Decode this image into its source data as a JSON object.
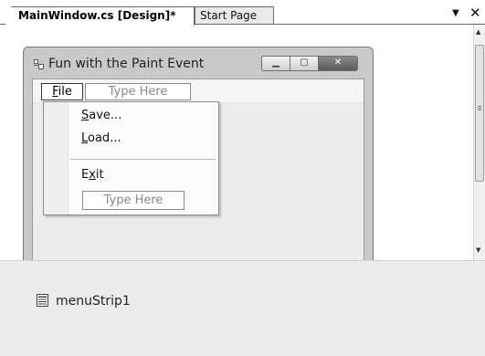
{
  "tabs": [
    {
      "label": "MainWindow.cs [Design]*",
      "active": true
    },
    {
      "label": "Start Page",
      "active": false
    }
  ],
  "tabstrip": {
    "dropdown_icon": "chevron-down-icon",
    "close_icon": "close-icon"
  },
  "form": {
    "title": "Fun with the Paint Event",
    "icon": "form-icon",
    "caption_buttons": [
      "minimize",
      "maximize",
      "close"
    ]
  },
  "menu": {
    "file_mnemonic": "F",
    "file_rest": "ile",
    "type_here": "Type Here",
    "items": [
      {
        "mnemonic": "S",
        "rest": "ave..."
      },
      {
        "mnemonic": "L",
        "rest": "oad..."
      },
      {
        "pre": "E",
        "mnemonic": "x",
        "rest": "it"
      }
    ],
    "dropdown_type_here": "Type Here"
  },
  "tray": {
    "component": "menuStrip1",
    "icon": "menustrip-icon"
  },
  "colors": {
    "tray_bg": "#ececec",
    "form_frame": "#c9c9c9"
  }
}
